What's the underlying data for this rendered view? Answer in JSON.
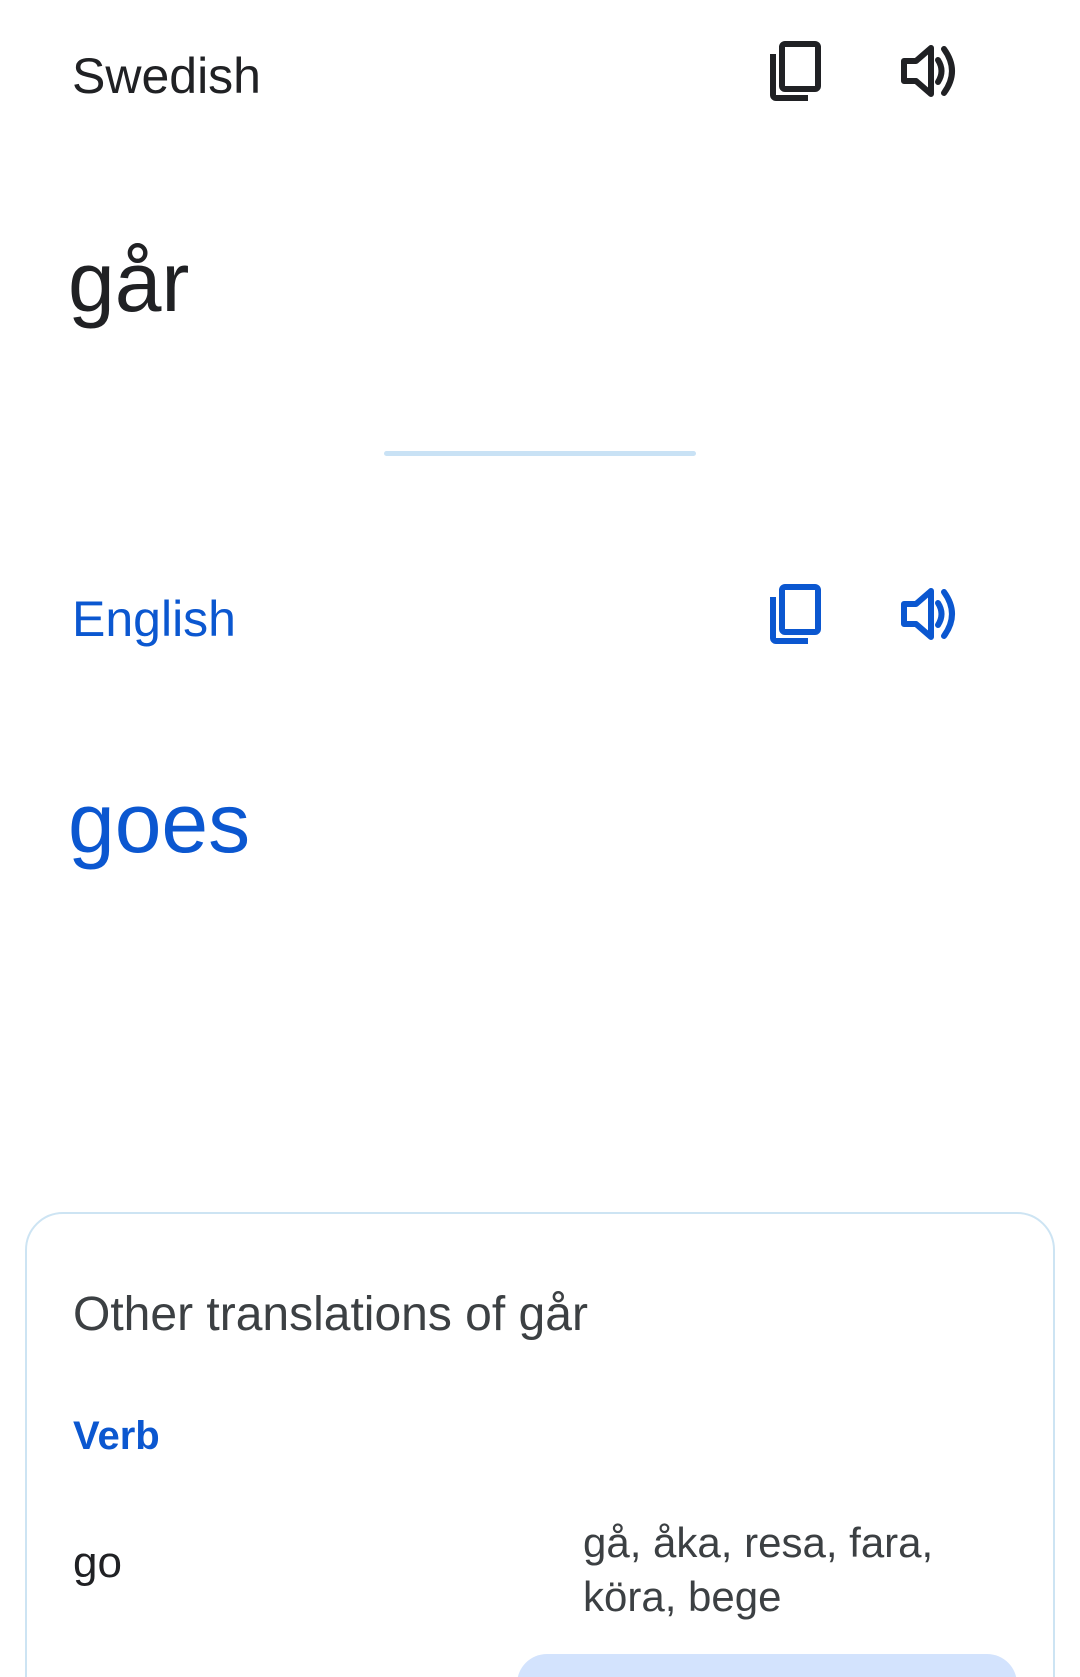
{
  "source": {
    "language": "Swedish",
    "text": "går",
    "copy_icon": "copy-icon",
    "speaker_icon": "volume-up-icon"
  },
  "target": {
    "language": "English",
    "text": "goes",
    "copy_icon": "copy-icon",
    "speaker_icon": "volume-up-icon"
  },
  "other_translations": {
    "title": "Other translations of går",
    "part_of_speech": "Verb",
    "entries": [
      {
        "word": "go",
        "back_translations": "gå, åka, resa, fara, köra, bege"
      }
    ]
  },
  "colors": {
    "text_primary": "#202124",
    "accent_blue": "#0b57d0",
    "divider": "#c9e2f5",
    "card_border": "#cde4f3",
    "chip": "#d3e3fd"
  }
}
